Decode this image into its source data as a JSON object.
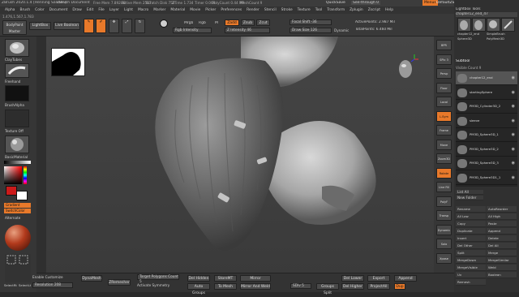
{
  "titlebar": {
    "app": "ZBrush 2020.1.4 [Henning Sanden]",
    "doc": "ZBrush Document",
    "stats": [
      "Free Mem 7.892GB",
      "Active Mem 2567",
      "Scratch Disk 752",
      "ZTime 1.734",
      "Timer 0.064",
      "PolyCount 0.44 MP",
      "MeshCount 9"
    ],
    "quicksave": "QuickSave",
    "seethrough": "See-through 0",
    "menus_label": "Menus",
    "script": "DefaultZScript"
  },
  "menubar": [
    "Alpha",
    "Brush",
    "Color",
    "Document",
    "Draw",
    "Edit",
    "File",
    "Layer",
    "Light",
    "Macro",
    "Marker",
    "Material",
    "Movie",
    "Picker",
    "Preferences",
    "Render",
    "Stencil",
    "Stroke",
    "Texture",
    "Tool",
    "Transform",
    "Zplugin",
    "Zscript",
    "Help"
  ],
  "coords": "1.476,1.567,1.783",
  "toolbar": {
    "projection": "BodyPaint Master",
    "lightbox": "LightBox",
    "livebool": "Live Boolean",
    "edit": "Edit",
    "draw": "Draw",
    "move": "Move",
    "scale": "Scale",
    "rotate": "Rotate",
    "mrgb": "Mrgb",
    "rgb": "Rgb",
    "m": "M",
    "zadd": "Zadd",
    "zsub": "Zsub",
    "zcut": "Zcut",
    "rgb_intensity": "Rgb Intensity",
    "z_intensity": "Z Intensity 46",
    "focal_shift": "Focal Shift -36",
    "draw_size": "Draw Size 126",
    "dynamic": "Dynamic",
    "active_points": "ActivePoints: 2.987 Mil",
    "total_points": "TotalPoints: 6.460 Mil"
  },
  "leftshelf": {
    "brushes": [
      "ClayTubes",
      "Standard",
      "Freehand"
    ],
    "alpha": "BrushAlpha",
    "texture": "Texture Off",
    "material": "BasicMaterial",
    "gradient": "Gradient",
    "switch_color": "SwitchColor",
    "alternate": "Alternate",
    "selectrt": "SelectRt",
    "selectlt": "SelectLt"
  },
  "rightshelf": [
    "BPR",
    "SPix 3",
    "Persp",
    "Floor",
    "Local",
    "L.Sym",
    "Frame",
    "Move",
    "Zoom3D",
    "Rotate",
    "Line Fill",
    "PolyF",
    "Transp",
    "Dynamic",
    "Solo",
    "Xpose"
  ],
  "rightpanel": {
    "tool_title": "Tool",
    "lightbox_tools": "Lightbox Tools",
    "current_tool": "chapter12_end_47",
    "thumbs": [
      "chapter12_end",
      "SimpleBrush",
      "Sphere3D",
      "PolyMesh3D"
    ],
    "subtool_title": "Subtool",
    "visible_count": "Visible Count 9",
    "subtools": [
      "chapter12_end",
      "startingSphere",
      "PM3D_Cylinder3D_2",
      "sleeve",
      "PM3D_Sphere3D_1",
      "PM3D_Sphere3D_2",
      "PM3D_Sphere3D_3",
      "PM3D_Sphere3D1_1"
    ],
    "list_all": "List All",
    "new_folder": "New Folder",
    "buttons": [
      "Rename",
      "AutoReorder",
      "All Low",
      "All High",
      "Copy",
      "Paste",
      "Duplicate",
      "Append",
      "Insert",
      "Delete",
      "Del Other",
      "Del All",
      "Split",
      "Merge",
      "MergeDown",
      "MergeSimilar",
      "MergeVisible",
      "Weld",
      "Uv",
      "Boolean",
      "Remesh"
    ]
  },
  "bottombar": {
    "enable_customize": "Enable Customize",
    "resolution": "Resolution 208",
    "dynamesh": "DynaMesh",
    "zremesher": "ZRemesher",
    "target_count": "Target Polygons Count 5",
    "activate_symmetry": "Activate Symmetry",
    "del_hidden": "Del Hidden",
    "auto_groups": "Auto Groups",
    "stroke": "StoreMT",
    "to_mesh": "To Mesh",
    "mirror": "Mirror",
    "mirror_weld": "Mirror And Weld",
    "sdiv": "SDiv 5",
    "groups_split": "Groups Split",
    "del_lower": "Del Lower",
    "del_higher": "Del Higher",
    "export": "Export",
    "project_all": "ProjectAll",
    "append": "Append",
    "dup": "Dup"
  },
  "colors": {
    "accent": "#e8792a",
    "primary_color": "#cc1a1a",
    "secondary_color": "#ffffff"
  }
}
